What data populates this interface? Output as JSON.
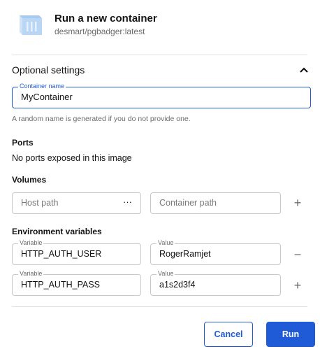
{
  "header": {
    "title": "Run a new container",
    "image": "desmart/pgbadger:latest",
    "icon": "container-box-icon"
  },
  "optional_settings": {
    "title": "Optional settings",
    "icon": "chevron-up-icon",
    "container_name": {
      "label": "Container name",
      "value": "MyContainer"
    },
    "hint": "A random name is generated if you do not provide one."
  },
  "ports": {
    "title": "Ports",
    "text": "No ports exposed in this image"
  },
  "volumes": {
    "title": "Volumes",
    "host_path_placeholder": "Host path",
    "container_path_placeholder": "Container path",
    "browse_label": "···"
  },
  "env": {
    "title": "Environment variables",
    "variable_label": "Variable",
    "value_label": "Value",
    "rows": [
      {
        "variable": "HTTP_AUTH_USER",
        "value": "RogerRamjet",
        "action": "remove"
      },
      {
        "variable": "HTTP_AUTH_PASS",
        "value": "a1s2d3f4",
        "action": "add"
      }
    ]
  },
  "actions": {
    "cancel": "Cancel",
    "run": "Run"
  },
  "colors": {
    "accent": "#1f5bd6",
    "icon_blue": "#b9d6f5"
  }
}
